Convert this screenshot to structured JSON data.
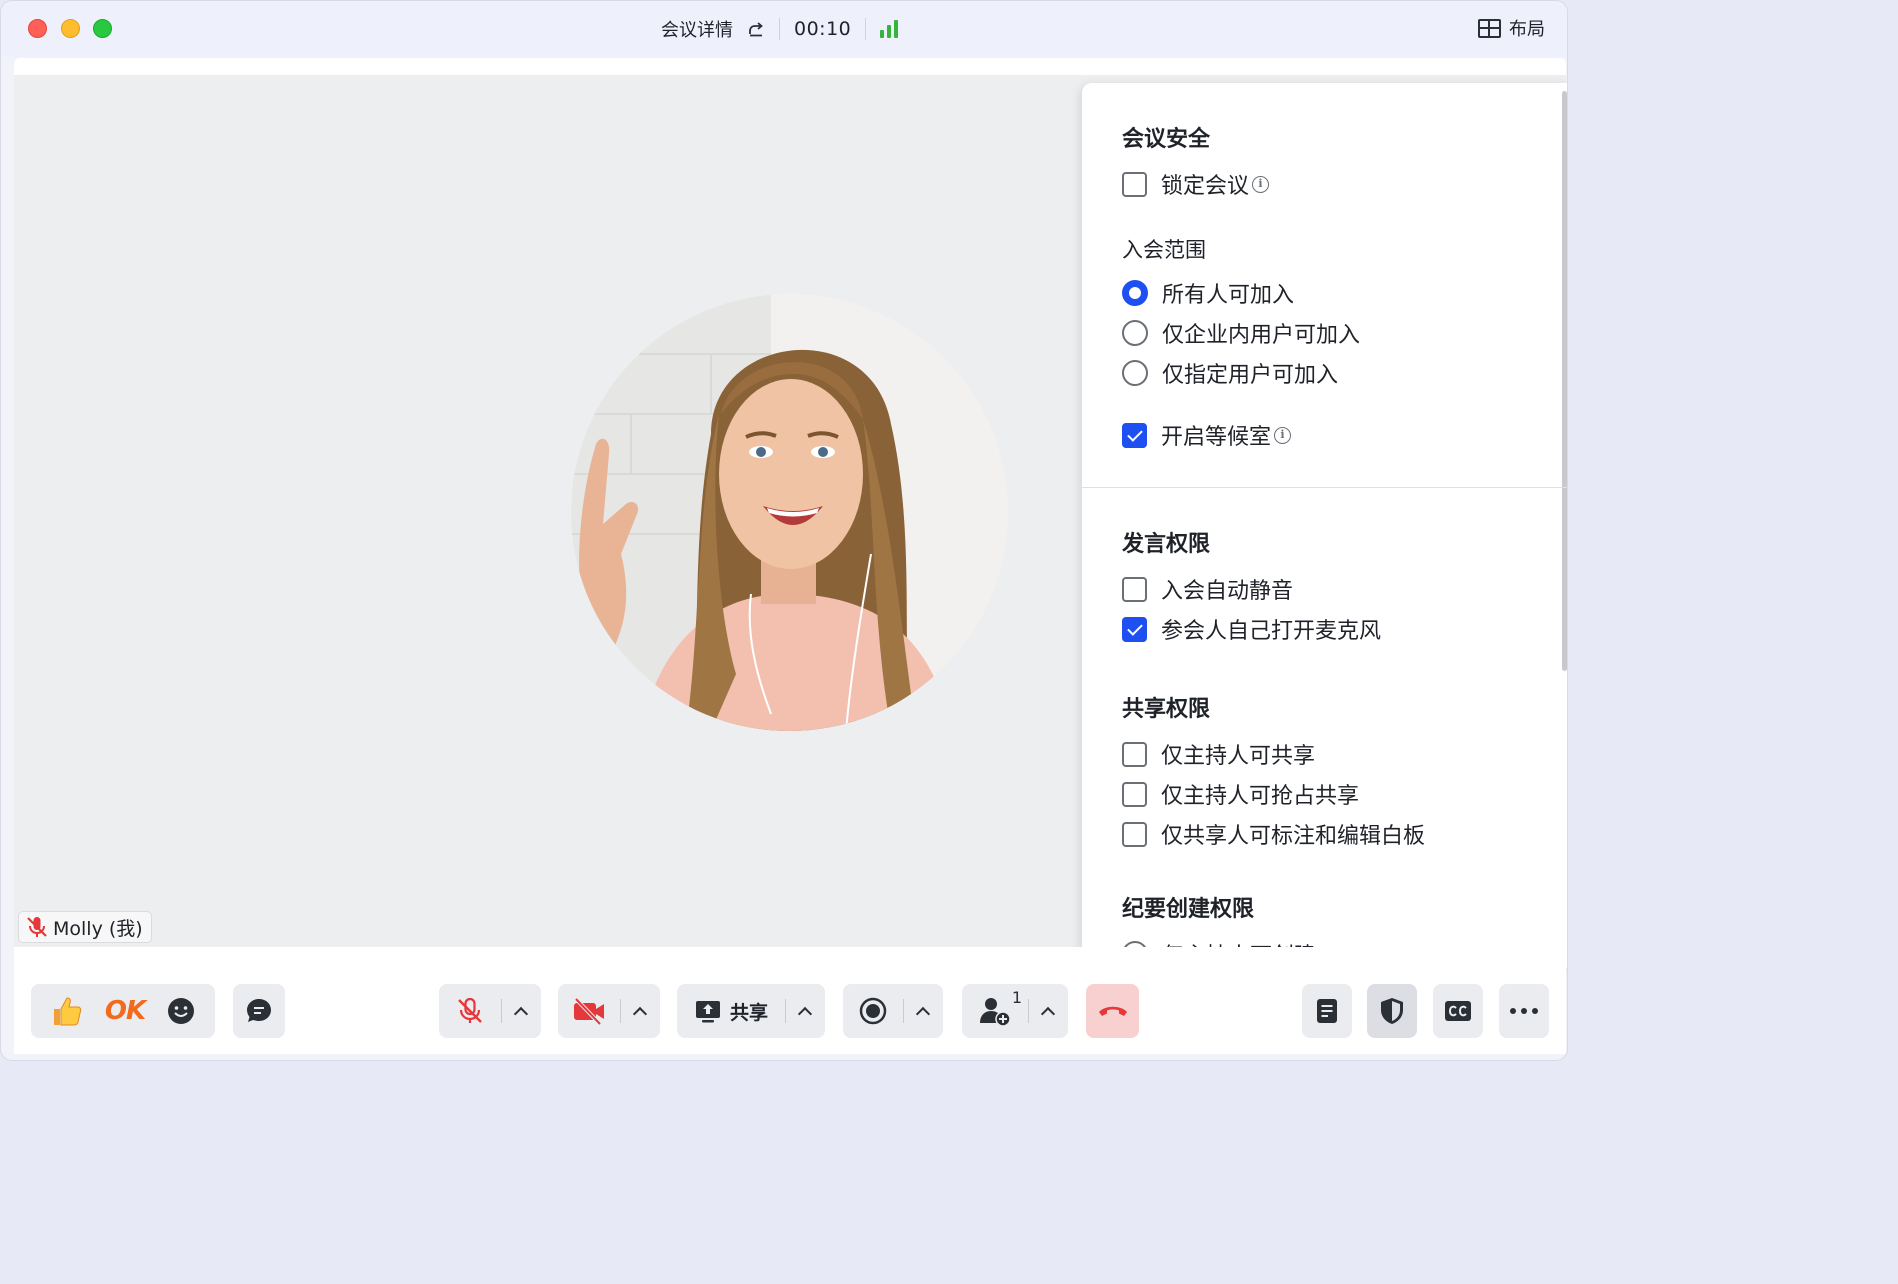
{
  "titlebar": {
    "meeting_details": "会议详情",
    "timer": "00:10",
    "layout_label": "布局"
  },
  "video": {
    "participant_name": "Molly (我)"
  },
  "security_panel": {
    "meeting_security_title": "会议安全",
    "lock_meeting": {
      "label": "锁定会议",
      "checked": false
    },
    "join_scope_title": "入会范围",
    "join_scope_options": [
      {
        "label": "所有人可加入",
        "selected": true
      },
      {
        "label": "仅企业内用户可加入",
        "selected": false
      },
      {
        "label": "仅指定用户可加入",
        "selected": false
      }
    ],
    "waiting_room": {
      "label": "开启等候室",
      "checked": true
    },
    "speak_title": "发言权限",
    "auto_mute": {
      "label": "入会自动静音",
      "checked": false
    },
    "self_unmute": {
      "label": "参会人自己打开麦克风",
      "checked": true
    },
    "share_title": "共享权限",
    "share_host_only": {
      "label": "仅主持人可共享",
      "checked": false
    },
    "share_host_preempt": {
      "label": "仅主持人可抢占共享",
      "checked": false
    },
    "share_annotate": {
      "label": "仅共享人可标注和编辑白板",
      "checked": false
    },
    "summary_title": "纪要创建权限",
    "summary_host_only": {
      "label": "仅主持人可创建",
      "selected": false
    }
  },
  "toolbar": {
    "ok_reaction": "OK",
    "share_label": "共享",
    "participants_count": "1"
  },
  "colors": {
    "accent": "#1e4ff0",
    "signal": "#34b53a",
    "hangup": "#f8d0cf",
    "muted_red": "#e5383b"
  }
}
